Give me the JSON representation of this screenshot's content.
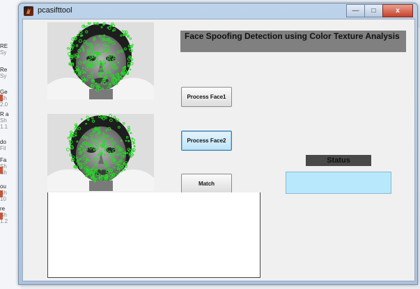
{
  "window": {
    "title": "pcasifttool",
    "minimize": "—",
    "maximize": "□",
    "close": "x"
  },
  "background_items": [
    {
      "t": "RE",
      "s": "Sy"
    },
    {
      "t": "Re",
      "s": "Sy"
    },
    {
      "t": "Ge",
      "s": "Sh",
      "x": "2.0"
    },
    {
      "t": "R a",
      "s": "Sh",
      "x": "1.1"
    },
    {
      "t": "do",
      "s": "Fil"
    },
    {
      "t": "Fa",
      "s": "Sh",
      "x": "Sh"
    },
    {
      "t": "ou",
      "s": "Sh",
      "x": "10"
    },
    {
      "t": "re",
      "s": "Sh",
      "x": "1.2"
    }
  ],
  "heading": "Face Spoofing Detection using Color Texture Analysis",
  "buttons": {
    "process_face1": "Process Face1",
    "process_face2": "Process Face2",
    "match": "Match"
  },
  "status": {
    "label": "Status",
    "value": ""
  },
  "colors": {
    "keypoint": "#22dd22",
    "banner": "#808080",
    "status_box": "#b8e8fb"
  }
}
